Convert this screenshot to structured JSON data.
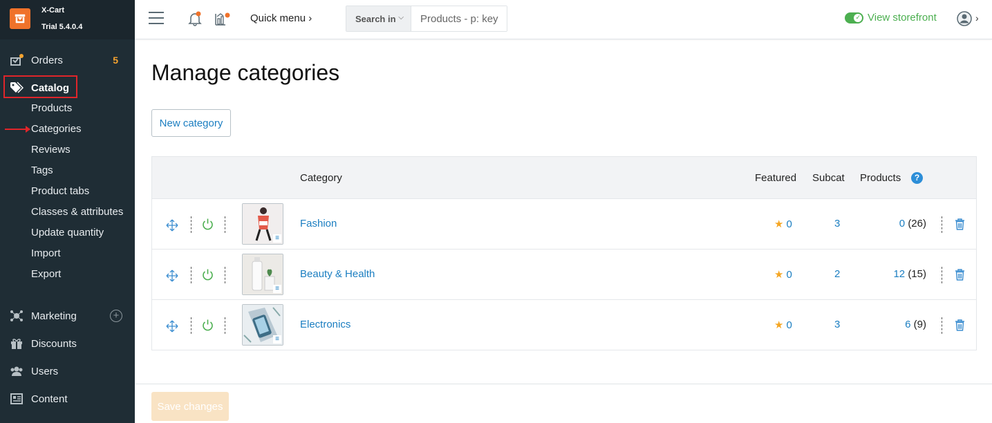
{
  "brand": {
    "name": "X-Cart",
    "version": "Trial 5.4.0.4"
  },
  "sidebar": {
    "orders": {
      "label": "Orders",
      "count": "5"
    },
    "catalog": {
      "label": "Catalog"
    },
    "catalog_sub": [
      "Products",
      "Categories",
      "Reviews",
      "Tags",
      "Product tabs",
      "Classes & attributes",
      "Update quantity",
      "Import",
      "Export"
    ],
    "marketing": {
      "label": "Marketing"
    },
    "discounts": {
      "label": "Discounts"
    },
    "users": {
      "label": "Users"
    },
    "content": {
      "label": "Content"
    }
  },
  "topbar": {
    "quick_menu": "Quick menu",
    "search_in": "Search in",
    "search_placeholder": "Products - p: key",
    "storefront": "View storefront"
  },
  "page": {
    "title": "Manage categories",
    "new_button": "New category",
    "save_button": "Save changes"
  },
  "table": {
    "headers": {
      "category": "Category",
      "featured": "Featured",
      "subcat": "Subcat",
      "products": "Products",
      "help": "?"
    },
    "rows": [
      {
        "name": "Fashion",
        "featured": "0",
        "subcat": "3",
        "products": "0",
        "products_total": "(26)"
      },
      {
        "name": "Beauty & Health",
        "featured": "0",
        "subcat": "2",
        "products": "12",
        "products_total": "(15)"
      },
      {
        "name": "Electronics",
        "featured": "0",
        "subcat": "3",
        "products": "6",
        "products_total": "(9)"
      }
    ]
  },
  "colors": {
    "accent": "#1b7ec1",
    "sidebar": "#1f2d35",
    "orange": "#f0722a",
    "green": "#4caf50",
    "highlight": "#e0252a"
  }
}
